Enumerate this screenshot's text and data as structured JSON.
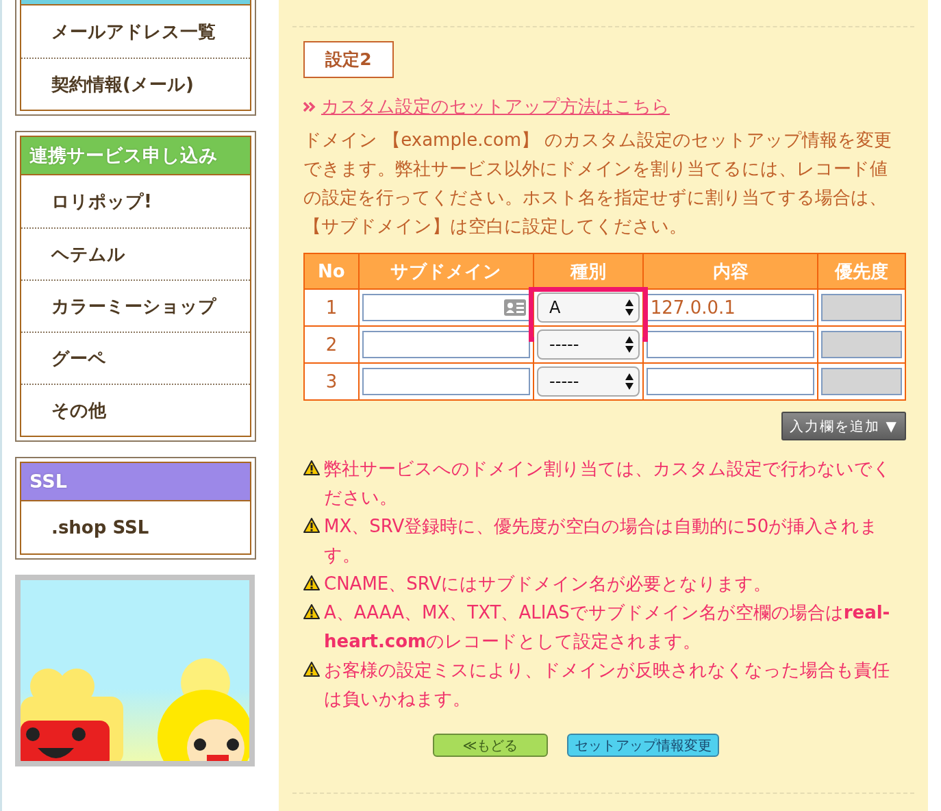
{
  "sidebar": {
    "sections": [
      {
        "color": "#6fd0e0",
        "items": [
          "メールアドレス一覧",
          "契約情報(メール)"
        ]
      },
      {
        "color": "#76c653",
        "title": "連携サービス申し込み",
        "items": [
          "ロリポップ!",
          "ヘテムル",
          "カラーミーショップ",
          "グーペ",
          "その他"
        ]
      },
      {
        "color": "#9c88e8",
        "title": "SSL",
        "items": [
          ".shop SSL"
        ]
      }
    ]
  },
  "section_title": "設定2",
  "help_link": "カスタム設定のセットアップ方法はこちら",
  "description": "ドメイン 【example.com】 のカスタム設定のセットアップ情報を変更できます。弊社サービス以外にドメインを割り当てるには、レコード値の設定を行ってください。ホスト名を指定せずに割り当てする場合は、【サブドメイン】は空白に設定してください。",
  "table": {
    "columns": [
      "No",
      "サブドメイン",
      "種別",
      "内容",
      "優先度"
    ],
    "rows": [
      {
        "no": "1",
        "subdomain": "",
        "autofill": true,
        "type": "A",
        "type_highlighted": true,
        "content": "127.0.0.1",
        "priority_disabled": true
      },
      {
        "no": "2",
        "subdomain": "",
        "autofill": false,
        "type": "-----",
        "type_highlighted": false,
        "content": "",
        "priority_disabled": true
      },
      {
        "no": "3",
        "subdomain": "",
        "autofill": false,
        "type": "-----",
        "type_highlighted": false,
        "content": "",
        "priority_disabled": true
      }
    ]
  },
  "add_rows_button": "入力欄を追加",
  "add_rows_caret": "▼",
  "notes": [
    "弊社サービスへのドメイン割り当ては、カスタム設定で行わないでください。",
    "MX、SRV登録時に、優先度が空白の場合は自動的に50が挿入されます。",
    "CNAME、SRVにはサブドメイン名が必要となります。",
    "A、AAAA、MX、TXT、ALIASでサブドメイン名が空欄の場合は**real-heart.com**のレコードとして設定されます。",
    "お客様の設定ミスにより、ドメインが反映されなくなった場合も責任は負いかねます。"
  ],
  "buttons": [
    {
      "kind": "back",
      "label": "≪もどる"
    },
    {
      "kind": "submit",
      "label": "セットアップ情報変更"
    }
  ]
}
